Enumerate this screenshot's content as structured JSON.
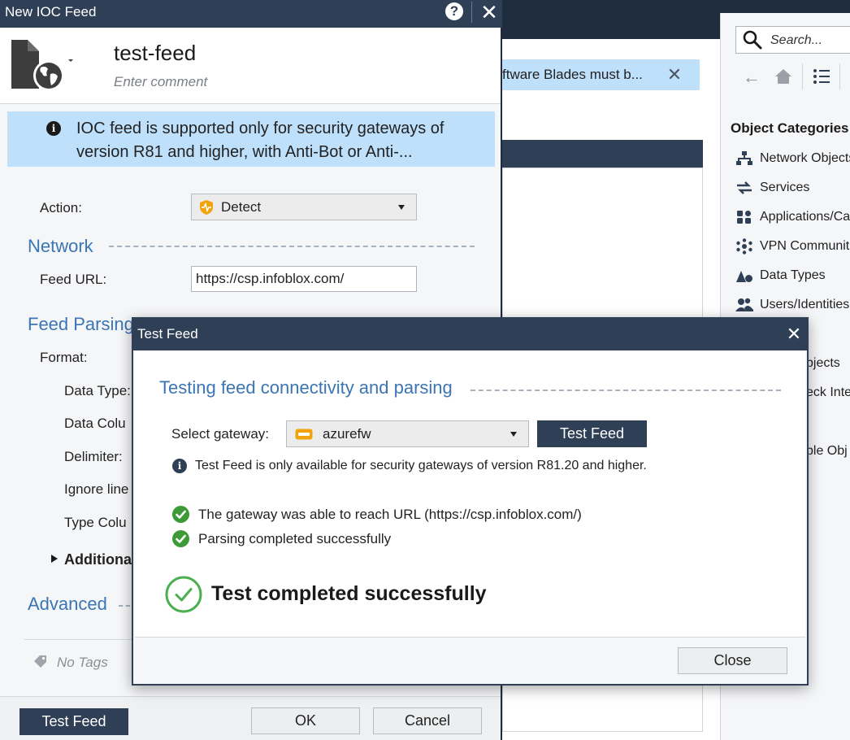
{
  "background": {
    "notice": "ftware Blades must b...",
    "search": {
      "placeholder": "Search..."
    },
    "object_categories": {
      "title": "Object Categories",
      "items": [
        {
          "label": "Network Objects",
          "icon": "network-objects-icon"
        },
        {
          "label": "Services",
          "icon": "services-icon"
        },
        {
          "label": "Applications/Categories",
          "icon": "applications-icon"
        },
        {
          "label": "VPN Communities",
          "icon": "vpn-communities-icon"
        },
        {
          "label": "Data Types",
          "icon": "data-types-icon"
        },
        {
          "label": "Users/Identities",
          "icon": "users-icon"
        }
      ],
      "partial_items": [
        "bjects",
        "eck Inte",
        "ble Obj"
      ]
    }
  },
  "ioc_dialog": {
    "title": "New IOC Feed",
    "feed_name": "test-feed",
    "comment_placeholder": "Enter comment",
    "info_banner": "IOC feed is supported only for security gateways of version R81 and higher, with Anti-Bot or Anti-...",
    "action": {
      "label": "Action:",
      "value": "Detect"
    },
    "network": {
      "section": "Network",
      "feed_url_label": "Feed URL:",
      "feed_url_value": "https://csp.infoblox.com/"
    },
    "feed_parsing": {
      "section": "Feed Parsing",
      "format_label": "Format:",
      "fields": [
        "Data Type:",
        "Data Colu",
        "Delimiter:",
        "Ignore line",
        "Type Colu"
      ],
      "additional": "Additiona"
    },
    "advanced": {
      "section": "Advanced"
    },
    "tags": "No Tags",
    "buttons": {
      "test_feed": "Test Feed",
      "ok": "OK",
      "cancel": "Cancel"
    }
  },
  "test_feed_dialog": {
    "title": "Test Feed",
    "section": "Testing feed connectivity and parsing",
    "gateway_label": "Select gateway:",
    "gateway_value": "azurefw",
    "test_button": "Test Feed",
    "note": "Test Feed is only available for security gateways of version R81.20 and higher.",
    "checks": [
      "The gateway was able to reach URL (https://csp.infoblox.com/)",
      "Parsing completed successfully"
    ],
    "result": "Test completed successfully",
    "close_button": "Close"
  },
  "colors": {
    "title_bar": "#2f3f55",
    "section_blue": "#3b75b3",
    "info_banner": "#bfe0fb",
    "success_green": "#3c9a37",
    "detect_shield": "#f0a30a"
  }
}
